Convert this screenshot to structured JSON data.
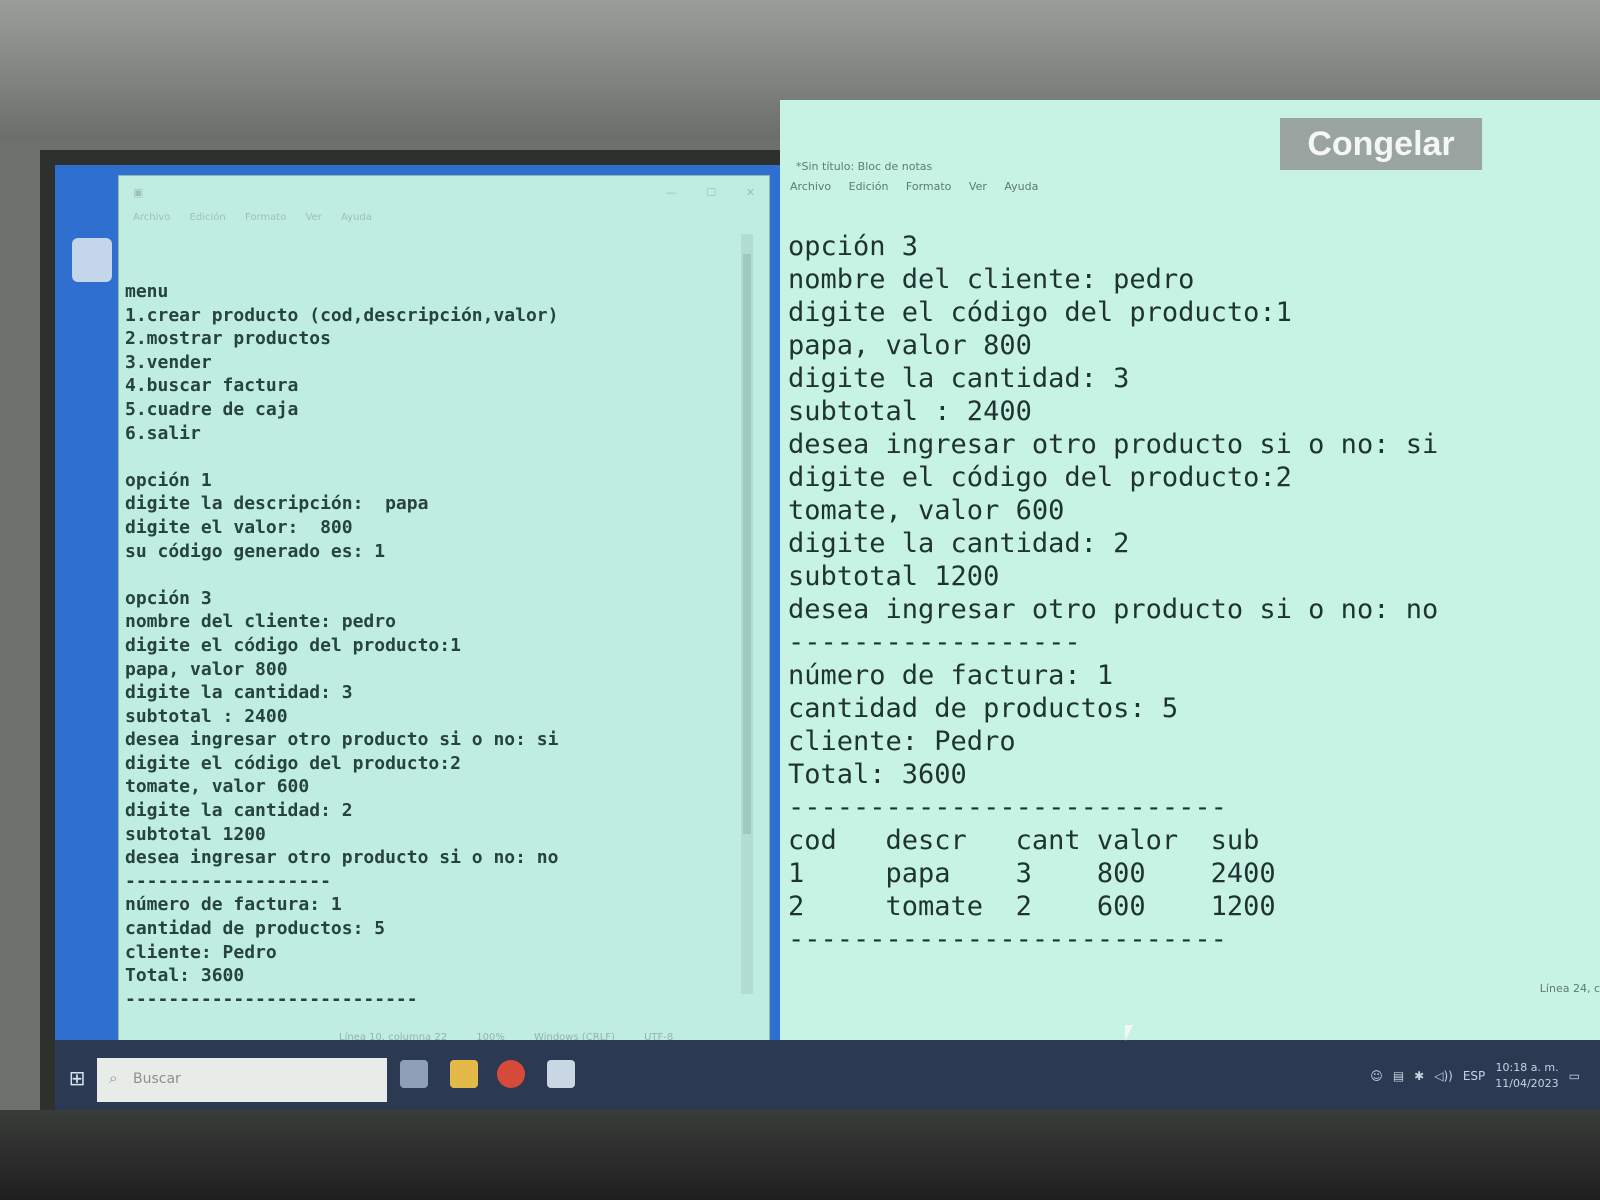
{
  "left_window": {
    "menu_items": [
      "Archivo",
      "Edición",
      "Formato",
      "Ver",
      "Ayuda"
    ],
    "window_controls": [
      "—",
      "☐",
      "✕"
    ],
    "text_lines": [
      "menu",
      "1.crear producto (cod,descripción,valor)",
      "2.mostrar productos",
      "3.vender",
      "4.buscar factura",
      "5.cuadre de caja",
      "6.salir",
      "",
      "opción 1",
      "digite la descripción:  papa",
      "digite el valor:  800",
      "su código generado es: 1",
      "",
      "opción 3",
      "nombre del cliente: pedro",
      "digite el código del producto:1",
      "papa, valor 800",
      "digite la cantidad: 3",
      "subtotal : 2400",
      "desea ingresar otro producto si o no: si",
      "digite el código del producto:2",
      "tomate, valor 600",
      "digite la cantidad: 2",
      "subtotal 1200",
      "desea ingresar otro producto si o no: no",
      "-------------------",
      "número de factura: 1",
      "cantidad de productos: 5",
      "cliente: Pedro",
      "Total: 3600",
      "---------------------------"
    ],
    "status": {
      "position": "Línea 10, columna 22",
      "zoom": "100%",
      "line_ending": "Windows (CRLF)",
      "encoding": "UTF-8"
    }
  },
  "right_window": {
    "title": "*Sin título: Bloc de notas",
    "menu_items": [
      "Archivo",
      "Edición",
      "Formato",
      "Ver",
      "Ayuda"
    ],
    "freeze_button": "Congelar",
    "text_lines": [
      "opción 3",
      "nombre del cliente: pedro",
      "digite el código del producto:1",
      "papa, valor 800",
      "digite la cantidad: 3",
      "subtotal : 2400",
      "desea ingresar otro producto si o no: si",
      "digite el código del producto:2",
      "tomate, valor 600",
      "digite la cantidad: 2",
      "subtotal 1200",
      "desea ingresar otro producto si o no: no",
      "------------------",
      "número de factura: 1",
      "cantidad de productos: 5",
      "cliente: Pedro",
      "Total: 3600",
      "---------------------------",
      "cod   descr   cant valor  sub",
      "1     papa    3    800    2400",
      "2     tomate  2    600    1200",
      "---------------------------"
    ],
    "status": "Línea 24, c"
  },
  "taskbar": {
    "search_placeholder": "Buscar",
    "language": "ESP",
    "time": "10:18 a. m.",
    "date": "11/04/2023"
  }
}
